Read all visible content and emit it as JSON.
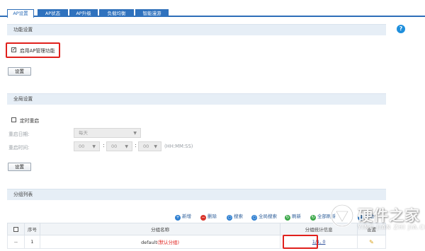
{
  "tabs": [
    {
      "label": "AP设置",
      "active": true
    },
    {
      "label": "AP状态",
      "active": false
    },
    {
      "label": "AP升级",
      "active": false
    },
    {
      "label": "负载均衡",
      "active": false
    },
    {
      "label": "智能漫游",
      "active": false
    }
  ],
  "help_icon": "?",
  "function_section": {
    "title": "功能设置",
    "enable_label": "启用AP管理功能",
    "enable_checked": true,
    "save_label": "设置"
  },
  "global_section": {
    "title": "全局设置",
    "timed_reboot_label": "定时重启",
    "timed_reboot_checked": false,
    "reboot_date_label": "重启日期:",
    "reboot_date_value": "每天",
    "reboot_time_label": "重启时间:",
    "hour_value": "00",
    "minute_value": "00",
    "second_value": "00",
    "time_colon": ":",
    "time_format_hint": "(HH:MM:SS)",
    "save_label": "设置"
  },
  "group_section": {
    "title": "分组列表",
    "toolbar": [
      {
        "label": "新增",
        "icon": "add-icon",
        "color": "#2e7fd1",
        "glyph": "+"
      },
      {
        "label": "删除",
        "icon": "delete-icon",
        "color": "#d9342b",
        "glyph": "−"
      },
      {
        "label": "搜索",
        "icon": "search-icon",
        "color": "#2e7fd1",
        "glyph": "○"
      },
      {
        "label": "全局搜索",
        "icon": "global-search-icon",
        "color": "#2e7fd1",
        "glyph": "○"
      },
      {
        "label": "刷新",
        "icon": "refresh-icon",
        "color": "#3ca84a",
        "glyph": "↻"
      },
      {
        "label": "全部刷新",
        "icon": "refresh-all-icon",
        "color": "#3ca84a",
        "glyph": "↻"
      },
      {
        "label": "帮助",
        "icon": "help-icon",
        "color": "#2e7fd1",
        "glyph": "?"
      }
    ],
    "columns": [
      "",
      "序号",
      "分组名称",
      "分组统计信息",
      "设置"
    ],
    "rows": [
      {
        "select": "--",
        "index": "1",
        "name": "default",
        "name_suffix": "(默认分组)",
        "stats": "1/1, 0",
        "action_icon": "edit-pencil-icon"
      }
    ]
  },
  "watermark": {
    "text": "硬件之家",
    "sub": "YING JIAN ZHI JIA.COM"
  },
  "colors": {
    "tab_blue": "#2f72be",
    "highlight_red": "#e0201c",
    "section_bg": "#e6eef6"
  }
}
